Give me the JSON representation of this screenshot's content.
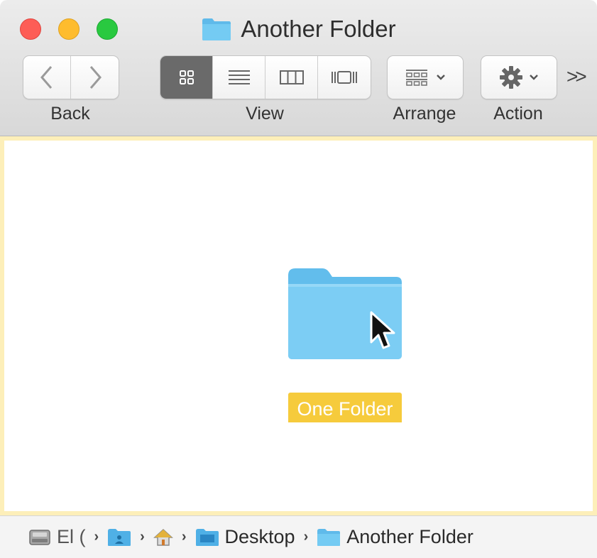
{
  "window": {
    "title": "Another Folder"
  },
  "toolbar": {
    "back_label": "Back",
    "view_label": "View",
    "arrange_label": "Arrange",
    "action_label": "Action",
    "overflow_symbol": ">>",
    "view_modes": [
      "icon-view",
      "list-view",
      "column-view",
      "gallery-view"
    ],
    "active_view": "icon-view"
  },
  "content": {
    "items": [
      {
        "name": "One Folder",
        "selected": true,
        "icon": "folder-icon"
      }
    ]
  },
  "path_bar": {
    "crumbs": [
      {
        "label": "El (",
        "icon": "disk-icon"
      },
      {
        "label": "",
        "icon": "user-folder-icon"
      },
      {
        "label": "",
        "icon": "home-icon"
      },
      {
        "label": "Desktop",
        "icon": "folder-icon"
      },
      {
        "label": "Another Folder",
        "icon": "folder-icon"
      }
    ]
  },
  "colors": {
    "selection_label": "#f6cb3c",
    "drop_target_border": "#fdefb9",
    "folder_blue": "#6cc4f0",
    "close": "#fd5d56",
    "minimize": "#febc2e",
    "zoom": "#29c940"
  }
}
